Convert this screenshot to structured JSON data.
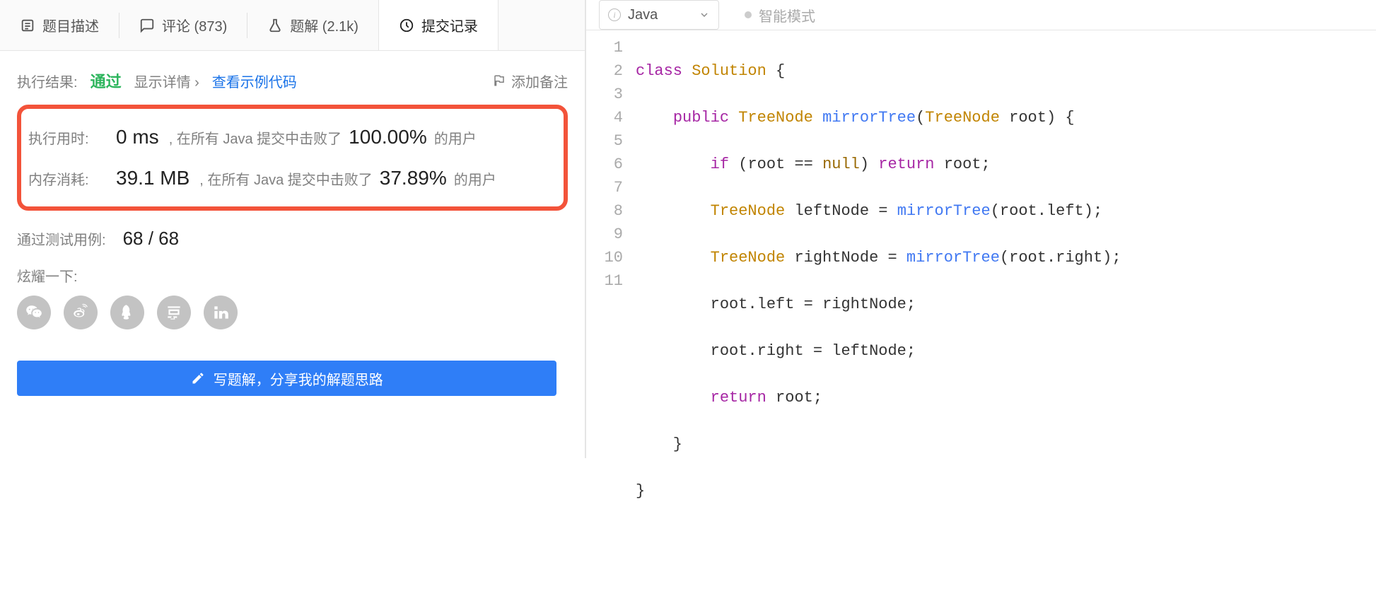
{
  "tabs": {
    "description": "题目描述",
    "comments": "评论 (873)",
    "solutions": "题解 (2.1k)",
    "submissions": "提交记录"
  },
  "result": {
    "label": "执行结果:",
    "status": "通过",
    "show_details": "显示详情 ›",
    "view_example": "查看示例代码",
    "add_note": "添加备注"
  },
  "stats": {
    "runtime_label": "执行用时:",
    "runtime_value": "0 ms",
    "runtime_mid": ", 在所有 Java 提交中击败了",
    "runtime_pct": "100.00%",
    "runtime_suffix": "的用户",
    "memory_label": "内存消耗:",
    "memory_value": "39.1 MB",
    "memory_mid": ", 在所有 Java 提交中击败了",
    "memory_pct": "37.89%",
    "memory_suffix": "的用户"
  },
  "cases": {
    "label": "通过测试用例:",
    "value": "68 / 68"
  },
  "share": {
    "label": "炫耀一下:"
  },
  "write_btn": "写题解，分享我的解题思路",
  "editor": {
    "language": "Java",
    "smart_mode": "智能模式"
  },
  "code_tokens": {
    "class": "class",
    "Solution": "Solution",
    "public": "public",
    "TreeNode": "TreeNode",
    "mirrorTree": "mirrorTree",
    "root": "root",
    "if": "if",
    "null": "null",
    "return": "return",
    "leftNode": "leftNode",
    "rightNode": "rightNode",
    "left": "left",
    "right": "right"
  }
}
